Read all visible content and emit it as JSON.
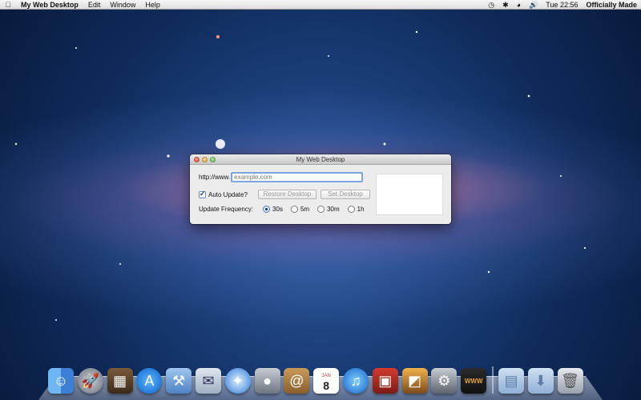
{
  "menubar": {
    "apple_icon": "apple-icon",
    "app_name": "My Web Desktop",
    "menus": [
      "Edit",
      "Window",
      "Help"
    ],
    "clock": "Tue 22:56",
    "user": "Officially Made"
  },
  "window": {
    "title": "My Web Desktop",
    "url_prefix": "http://www.",
    "url_placeholder": "example.com",
    "auto_update_label": "Auto Update?",
    "auto_update_checked": true,
    "restore_button": "Restore Desktop",
    "set_button": "Set Desktop",
    "frequency_label": "Update Frequency:",
    "frequency_options": [
      "30s",
      "5m",
      "30m",
      "1h"
    ],
    "frequency_selected": "30s"
  },
  "dock": {
    "items": [
      "finder-icon",
      "launchpad-icon",
      "photo-booth-icon",
      "app-store-icon",
      "xcode-icon",
      "mail-stamp-icon",
      "safari-icon",
      "facetime-icon",
      "address-book-icon",
      "calendar-icon",
      "itunes-icon",
      "photo-booth-film-icon",
      "iphoto-icon",
      "system-preferences-icon",
      "my-web-desktop-icon",
      "documents-folder-icon",
      "downloads-folder-icon",
      "trash-icon"
    ],
    "calendar_month": "JAN",
    "calendar_day": "8",
    "web_app_label": "WWW"
  }
}
